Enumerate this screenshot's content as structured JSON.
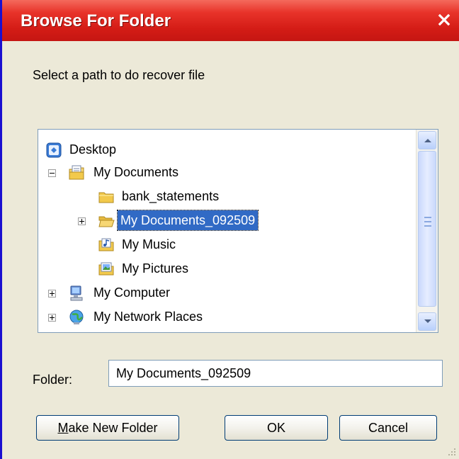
{
  "dialog": {
    "title": "Browse For Folder",
    "close_icon": "close-icon",
    "prompt": "Select a path to do recover file"
  },
  "tree": {
    "items": [
      {
        "label": "Desktop",
        "icon": "desktop-icon",
        "expander": "none",
        "level": 0,
        "selected": false
      },
      {
        "label": "My Documents",
        "icon": "my-documents-icon",
        "expander": "minus",
        "level": 1,
        "selected": false
      },
      {
        "label": "bank_statements",
        "icon": "folder-icon",
        "expander": "none",
        "level": 2,
        "selected": false
      },
      {
        "label": "My Documents_092509",
        "icon": "open-folder-icon",
        "expander": "plus",
        "level": 2,
        "selected": true
      },
      {
        "label": "My Music",
        "icon": "music-folder-icon",
        "expander": "none",
        "level": 2,
        "selected": false
      },
      {
        "label": "My Pictures",
        "icon": "pictures-folder-icon",
        "expander": "none",
        "level": 2,
        "selected": false
      },
      {
        "label": "My Computer",
        "icon": "computer-icon",
        "expander": "plus",
        "level": 1,
        "selected": false
      },
      {
        "label": "My Network Places",
        "icon": "network-icon",
        "expander": "plus",
        "level": 1,
        "selected": false
      }
    ]
  },
  "folder": {
    "label": "Folder:",
    "value": "My Documents_092509"
  },
  "buttons": {
    "make_new_folder_prefix": "M",
    "make_new_folder_rest": "ake New Folder",
    "ok": "OK",
    "cancel": "Cancel"
  },
  "colors": {
    "titlebar": "#d41c16",
    "selection": "#316ac5",
    "dialog_bg": "#ece9d8"
  }
}
